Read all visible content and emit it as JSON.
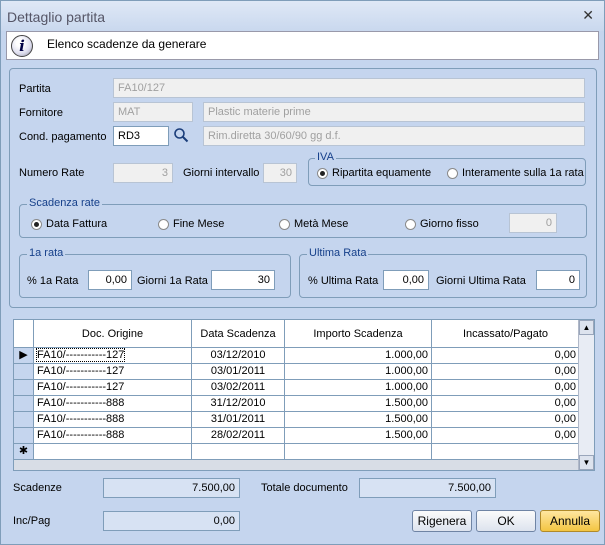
{
  "window": {
    "title": "Dettaglio partita",
    "close_glyph": "✕"
  },
  "info": {
    "icon": "info-icon",
    "text": "Elenco scadenze da generare"
  },
  "form": {
    "partita_label": "Partita",
    "partita_value": "FA10/127",
    "fornitore_label": "Fornitore",
    "fornitore_code": "MAT",
    "fornitore_name": "Plastic materie prime",
    "cond_label": "Cond. pagamento",
    "cond_code": "RD3",
    "cond_desc": "Rim.diretta 30/60/90 gg d.f.",
    "numero_rate_label": "Numero Rate",
    "numero_rate_value": "3",
    "giorni_intervallo_label": "Giorni intervallo",
    "giorni_intervallo_value": "30"
  },
  "iva": {
    "legend": "IVA",
    "opt1": "Ripartita equamente",
    "opt2": "Interamente sulla 1a rata",
    "selected": 1
  },
  "scadenza": {
    "legend": "Scadenza rate",
    "opt1": "Data Fattura",
    "opt2": "Fine Mese",
    "opt3": "Metà Mese",
    "opt4": "Giorno fisso",
    "giorno_value": "0",
    "selected": 1
  },
  "prima_rata": {
    "legend": "1a rata",
    "pct_label": "% 1a  Rata",
    "pct_value": "0,00",
    "giorni_label": "Giorni 1a Rata",
    "giorni_value": "30"
  },
  "ultima_rata": {
    "legend": "Ultima Rata",
    "pct_label": "% Ultima Rata",
    "pct_value": "0,00",
    "giorni_label": "Giorni Ultima Rata",
    "giorni_value": "0"
  },
  "grid": {
    "columns": [
      "Doc. Origine",
      "Data Scadenza",
      "Importo Scadenza",
      "Incassato/Pagato"
    ],
    "rows": [
      {
        "doc": "FA10/-----------127",
        "data": "03/12/2010",
        "importo": "1.000,00",
        "incassato": "0,00"
      },
      {
        "doc": "FA10/-----------127",
        "data": "03/01/2011",
        "importo": "1.000,00",
        "incassato": "0,00"
      },
      {
        "doc": "FA10/-----------127",
        "data": "03/02/2011",
        "importo": "1.000,00",
        "incassato": "0,00"
      },
      {
        "doc": "FA10/-----------888",
        "data": "31/12/2010",
        "importo": "1.500,00",
        "incassato": "0,00"
      },
      {
        "doc": "FA10/-----------888",
        "data": "31/01/2011",
        "importo": "1.500,00",
        "incassato": "0,00"
      },
      {
        "doc": "FA10/-----------888",
        "data": "28/02/2011",
        "importo": "1.500,00",
        "incassato": "0,00"
      }
    ],
    "current_marker": "▶",
    "new_marker": "✱"
  },
  "totals": {
    "scadenze_label": "Scadenze",
    "scadenze_value": "7.500,00",
    "totale_label": "Totale documento",
    "totale_value": "7.500,00",
    "incpag_label": "Inc/Pag",
    "incpag_value": "0,00"
  },
  "buttons": {
    "rigenera": "Rigenera",
    "ok": "OK",
    "annulla": "Annulla"
  }
}
